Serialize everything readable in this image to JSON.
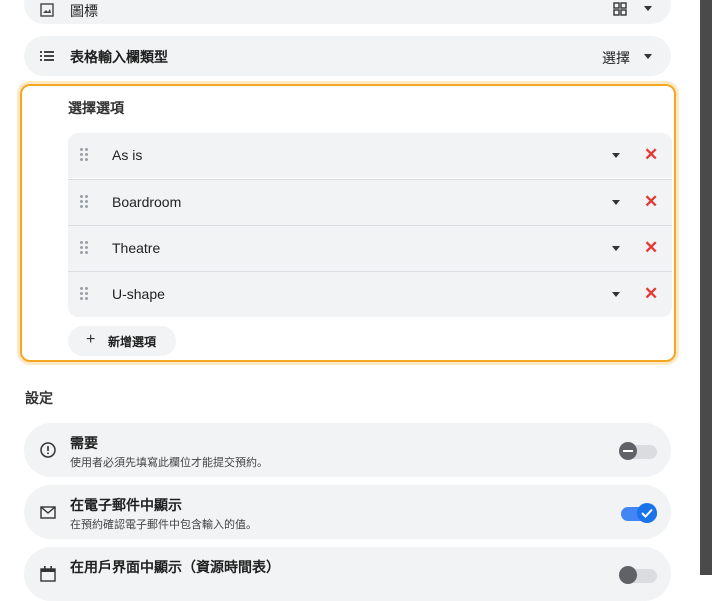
{
  "top_row": {
    "label": "圖標",
    "icon": "image-icon",
    "value_icon": "grid-icon"
  },
  "input_type_row": {
    "label": "表格輸入欄類型",
    "value": "選擇"
  },
  "options": {
    "title": "選擇選項",
    "items": [
      {
        "label": "As is"
      },
      {
        "label": "Boardroom"
      },
      {
        "label": "Theatre"
      },
      {
        "label": "U-shape"
      }
    ],
    "add_label": "新增選項"
  },
  "settings": {
    "heading": "設定",
    "items": [
      {
        "title": "需要",
        "subtitle": "使用者必須先填寫此欄位才能提交預約。",
        "icon": "info-icon",
        "enabled": false
      },
      {
        "title": "在電子郵件中顯示",
        "subtitle": "在預約確認電子郵件中包含輸入的值。",
        "icon": "mail-icon",
        "enabled": true
      },
      {
        "title": "在用戶界面中顯示（資源時間表）",
        "subtitle": "",
        "icon": "calendar-icon",
        "enabled": false
      }
    ]
  },
  "colors": {
    "accent": "#1a73e8",
    "toggle_on": "#4285f4",
    "delete": "#e53935",
    "focus_border": "#f5a623"
  }
}
